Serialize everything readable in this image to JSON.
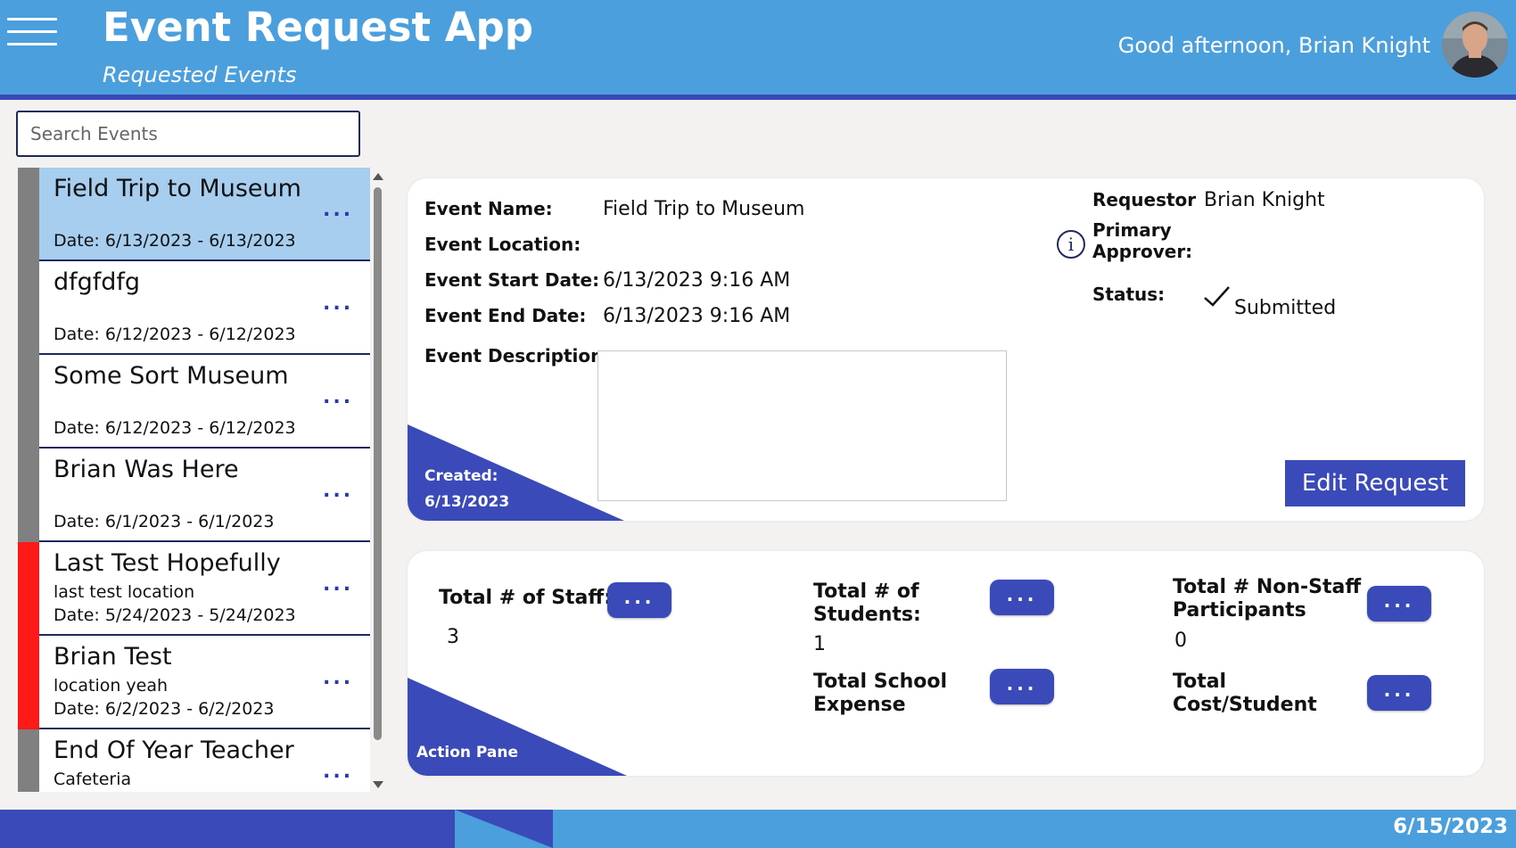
{
  "header": {
    "title": "Event Request App",
    "subtitle": "Requested Events",
    "greeting": "Good afternoon,  Brian Knight",
    "menu_icon": "hamburger-menu-icon"
  },
  "search": {
    "placeholder": "Search Events",
    "value": ""
  },
  "events": [
    {
      "title": "Field Trip to Museum",
      "location": "",
      "date": "Date: 6/13/2023 - 6/13/2023",
      "stripe_color": "#808080",
      "selected": true
    },
    {
      "title": "dfgfdfg",
      "location": "",
      "date": "Date: 6/12/2023 - 6/12/2023",
      "stripe_color": "#808080"
    },
    {
      "title": "Some Sort Museum",
      "location": "",
      "date": "Date: 6/12/2023 - 6/12/2023",
      "stripe_color": "#808080"
    },
    {
      "title": "Brian Was Here",
      "location": "",
      "date": "Date: 6/1/2023 - 6/1/2023",
      "stripe_color": "#808080"
    },
    {
      "title": "Last Test Hopefully",
      "location": "last test location",
      "date": "Date: 5/24/2023 - 5/24/2023",
      "stripe_color": "#ff1a1a"
    },
    {
      "title": "Brian Test",
      "location": "location yeah",
      "date": "Date: 6/2/2023 - 6/2/2023",
      "stripe_color": "#ff1a1a"
    },
    {
      "title": "End Of Year Teacher",
      "location": "Cafeteria",
      "date": "",
      "stripe_color": "#808080"
    }
  ],
  "item_menu_label": "...",
  "details": {
    "event_name_label": "Event Name:",
    "event_name": "Field Trip to Museum",
    "event_location_label": "Event Location:",
    "event_location": "",
    "start_label": "Event Start Date:",
    "start": "6/13/2023 9:16 AM",
    "end_label": "Event End Date:",
    "end": "6/13/2023 9:16 AM",
    "description_label": "Event Description:",
    "description": "",
    "requestor_label": "Requestor",
    "requestor": "Brian Knight",
    "approver_label_1": "Primary",
    "approver_label_2": "Approver:",
    "status_label": "Status:",
    "status": "Submitted",
    "created_label": "Created:",
    "created": "6/13/2023",
    "edit_button": "Edit Request"
  },
  "action_pane": {
    "label": "Action Pane",
    "staff_label": "Total # of Staff:",
    "staff_value": "3",
    "students_label_1": "Total # of",
    "students_label_2": "Students:",
    "students_value": "1",
    "nonstaff_label_1": "Total # Non-Staff",
    "nonstaff_label_2": "Participants",
    "nonstaff_value": "0",
    "expense_label_1": "Total School",
    "expense_label_2": "Expense",
    "cost_label_1": "Total",
    "cost_label_2": "Cost/Student",
    "button_label": "..."
  },
  "footer": {
    "date": "6/15/2023"
  },
  "colors": {
    "header_blue": "#4a9fdc",
    "accent_navy": "#3a4ab8",
    "selected_item": "#a7cdef",
    "stripe_gray": "#808080",
    "stripe_red": "#ff1a1a"
  }
}
